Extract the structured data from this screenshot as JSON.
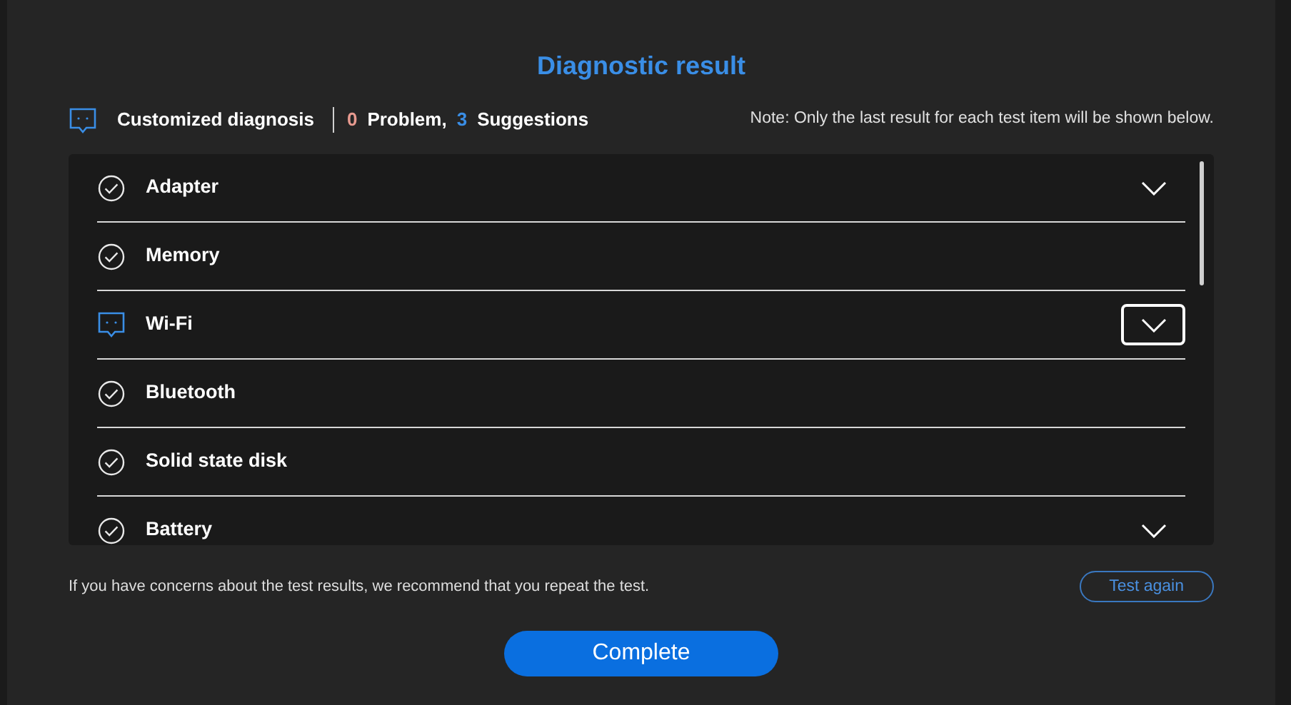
{
  "title": "Diagnostic result",
  "summary": {
    "mode": "Customized diagnosis",
    "problem_count": "0",
    "problem_label": "Problem,",
    "suggestion_count": "3",
    "suggestion_label": "Suggestions",
    "note": "Note: Only the last result for each test item will be shown below."
  },
  "items": [
    {
      "label": "Adapter",
      "kind": "pass",
      "expandable": true,
      "focused": false
    },
    {
      "label": "Memory",
      "kind": "pass",
      "expandable": false,
      "focused": false
    },
    {
      "label": "Wi-Fi",
      "kind": "suggestion",
      "expandable": true,
      "focused": true
    },
    {
      "label": "Bluetooth",
      "kind": "pass",
      "expandable": false,
      "focused": false
    },
    {
      "label": "Solid state disk",
      "kind": "pass",
      "expandable": false,
      "focused": false
    },
    {
      "label": "Battery",
      "kind": "pass",
      "expandable": true,
      "focused": false
    }
  ],
  "footer": {
    "hint": "If you have concerns about the test results, we recommend that you repeat the test.",
    "retry_button": "Test again"
  },
  "primary_button": "Complete"
}
